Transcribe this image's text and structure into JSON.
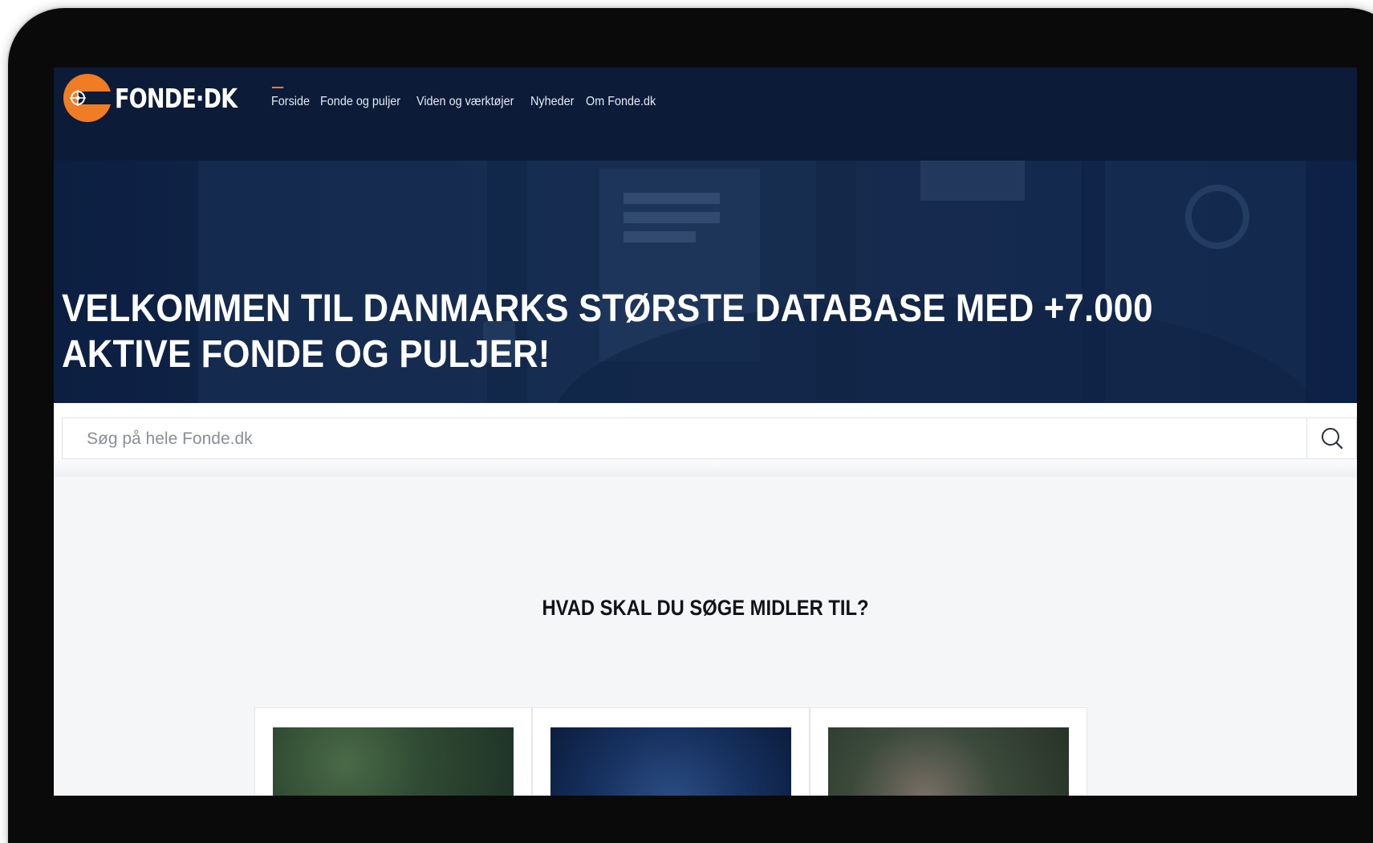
{
  "brand": {
    "name": "FONDE·DK",
    "accent_color": "#f07c24",
    "navy_color": "#0b1b38"
  },
  "nav": {
    "items": [
      {
        "label": "Forside",
        "active": true
      },
      {
        "label": "Fonde og puljer",
        "active": false
      },
      {
        "label": "Viden og værktøjer",
        "active": false
      },
      {
        "label": "Nyheder",
        "active": false
      },
      {
        "label": "Om Fonde.dk",
        "active": false
      }
    ]
  },
  "hero": {
    "title": "VELKOMMEN TIL DANMARKS STØRSTE DATABASE MED +7.000 AKTIVE FONDE OG PULJER!"
  },
  "search": {
    "placeholder": "Søg på hele Fonde.dk",
    "value": "",
    "icon": "search-icon"
  },
  "section": {
    "title": "HVAD SKAL DU SØGE MIDLER TIL?"
  },
  "cards": [
    {
      "image": "forest-trees-photo"
    },
    {
      "image": "stage-performers-photo"
    },
    {
      "image": "child-outdoors-photo"
    }
  ]
}
